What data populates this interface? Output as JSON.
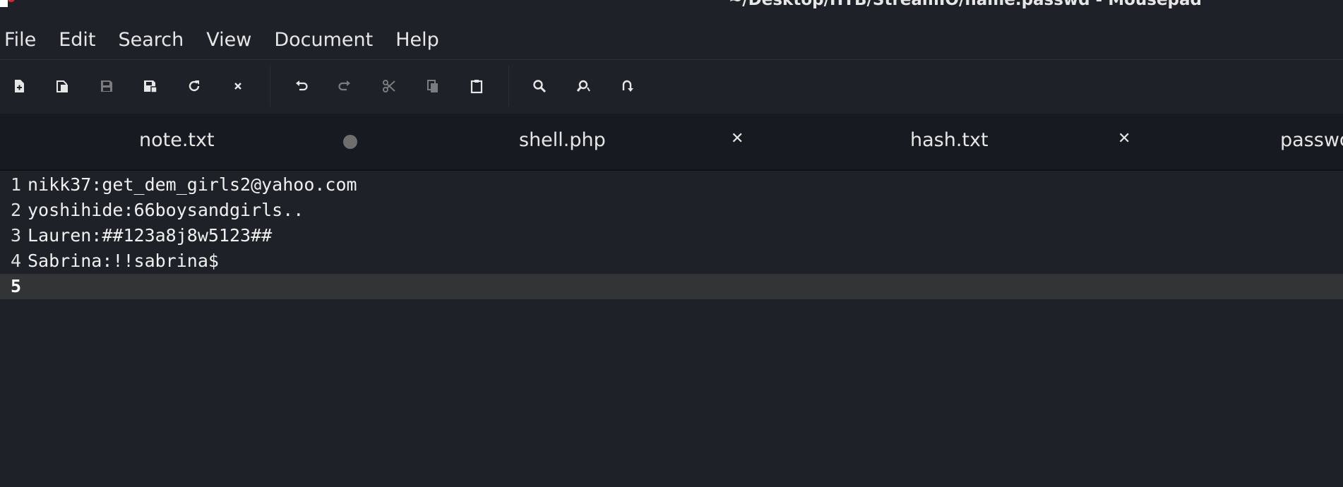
{
  "window": {
    "title": "~/Desktop/HTB/StreamIO/name.passwd - Mousepad"
  },
  "menubar": {
    "items": [
      "File",
      "Edit",
      "Search",
      "View",
      "Document",
      "Help"
    ]
  },
  "toolbar": {
    "buttons": [
      {
        "name": "new-document-icon",
        "enabled": true
      },
      {
        "name": "new-window-icon",
        "enabled": true
      },
      {
        "name": "save-icon",
        "enabled": false
      },
      {
        "name": "save-as-icon",
        "enabled": true
      },
      {
        "name": "reload-icon",
        "enabled": true
      },
      {
        "name": "close-document-icon",
        "enabled": true
      },
      {
        "name": "undo-icon",
        "enabled": true
      },
      {
        "name": "redo-icon",
        "enabled": false
      },
      {
        "name": "cut-icon",
        "enabled": false
      },
      {
        "name": "copy-icon",
        "enabled": false
      },
      {
        "name": "paste-icon",
        "enabled": true
      },
      {
        "name": "find-icon",
        "enabled": true
      },
      {
        "name": "find-replace-icon",
        "enabled": true
      },
      {
        "name": "go-to-line-icon",
        "enabled": true
      }
    ]
  },
  "tabs": [
    {
      "label": "note.txt",
      "state": "modified"
    },
    {
      "label": "shell.php",
      "state": "close"
    },
    {
      "label": "hash.txt",
      "state": "close"
    },
    {
      "label": "passwd",
      "state": "active"
    }
  ],
  "editor": {
    "lines": [
      {
        "num": "1",
        "text": "nikk37:get_dem_girls2@yahoo.com"
      },
      {
        "num": "2",
        "text": "yoshihide:66boysandgirls.."
      },
      {
        "num": "3",
        "text": "Lauren:##123a8j8w5123##"
      },
      {
        "num": "4",
        "text": "Sabrina:!!sabrina$"
      },
      {
        "num": "5",
        "text": ""
      }
    ],
    "current_line": "5"
  },
  "colors": {
    "background": "#1e2128",
    "tabbar": "#171a20",
    "current_line": "#333435",
    "text": "#e6e6e6",
    "disabled_icon": "#7a7c80"
  }
}
